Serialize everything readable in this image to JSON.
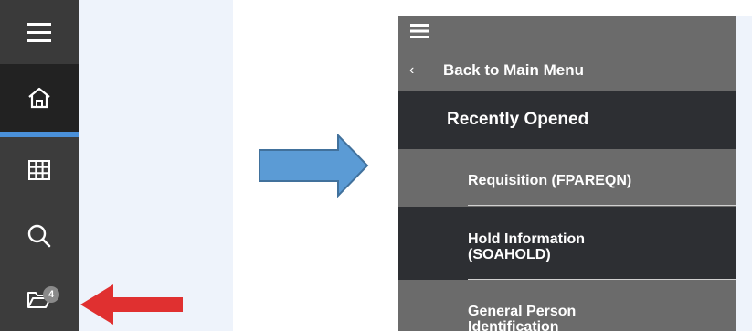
{
  "sidebar": {
    "items": [
      {
        "name": "menu",
        "icon": "hamburger-menu-icon"
      },
      {
        "name": "home",
        "icon": "home-icon",
        "active": true
      },
      {
        "name": "applications",
        "icon": "grid-icon"
      },
      {
        "name": "search",
        "icon": "search-icon"
      },
      {
        "name": "recently-opened",
        "icon": "folder-open-icon",
        "badge": "4"
      }
    ],
    "active_color": "#4a90d9"
  },
  "annotations": {
    "red_arrow_color": "#e03030",
    "blue_arrow_color": "#5b9bd5"
  },
  "menu_panel": {
    "back_chevron": "‹",
    "back_label": "Back to Main Menu",
    "section_title": "Recently Opened",
    "items": [
      {
        "label": "Requisition (FPAREQN)"
      },
      {
        "label": "Hold Information (SOAHOLD)"
      },
      {
        "label": "General Person Identification"
      }
    ]
  }
}
